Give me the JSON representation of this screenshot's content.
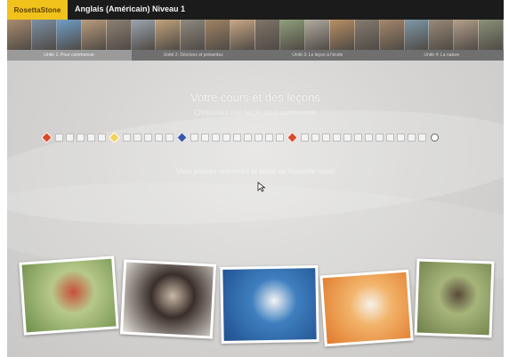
{
  "app": {
    "logo_text": "RosettaStone",
    "course_title": "Anglais (Américain) Niveau 1"
  },
  "image_strip": [
    {
      "icon": "group-photo",
      "color": "#a98b6e"
    },
    {
      "icon": "family-photo",
      "color": "#7b8fa3"
    },
    {
      "icon": "sky-photo",
      "color": "#6f9ec9"
    },
    {
      "icon": "people-photo",
      "color": "#b99c7c"
    },
    {
      "icon": "city-photo",
      "color": "#8d8072"
    },
    {
      "icon": "boat-photo",
      "color": "#9aa6ad"
    },
    {
      "icon": "portrait-photo",
      "color": "#c2a27a"
    },
    {
      "icon": "street-photo",
      "color": "#8f8a7e"
    },
    {
      "icon": "market-photo",
      "color": "#a18364"
    },
    {
      "icon": "child-photo",
      "color": "#c9a886"
    },
    {
      "icon": "crowd-photo",
      "color": "#7f7467"
    },
    {
      "icon": "garden-photo",
      "color": "#8ea07a"
    },
    {
      "icon": "clock-photo",
      "color": "#b1aaa0"
    },
    {
      "icon": "food-photo",
      "color": "#b98f63"
    },
    {
      "icon": "building-photo",
      "color": "#857b6f"
    },
    {
      "icon": "friends-photo",
      "color": "#a4876b"
    },
    {
      "icon": "water-photo",
      "color": "#7d99a8"
    },
    {
      "icon": "pattern-photo",
      "color": "#9a8a78"
    },
    {
      "icon": "fabric-photo",
      "color": "#b3a08a"
    },
    {
      "icon": "landscape-photo",
      "color": "#8a9279"
    }
  ],
  "units": [
    {
      "label": "Unité 1: Pour commencer",
      "active": true
    },
    {
      "label": "Unité 2: Décrivez et présentez",
      "active": false
    },
    {
      "label": "Unité 3: Le leçon à l'école",
      "active": false
    },
    {
      "label": "Unité 4: La nature",
      "active": false
    }
  ],
  "main": {
    "heading": "Votre cours et des leçons",
    "subheading": "Choisissez une leçon pour commencer",
    "prompt": "Vous pouvez reprendre la leçon ou Nouvelle leçon"
  },
  "lesson_track": [
    {
      "type": "marker",
      "color": "red"
    },
    {
      "type": "lesson"
    },
    {
      "type": "lesson"
    },
    {
      "type": "lesson"
    },
    {
      "type": "lesson"
    },
    {
      "type": "lesson"
    },
    {
      "type": "marker",
      "color": "yellow"
    },
    {
      "type": "lesson"
    },
    {
      "type": "lesson"
    },
    {
      "type": "lesson"
    },
    {
      "type": "lesson"
    },
    {
      "type": "lesson"
    },
    {
      "type": "marker",
      "color": "blue"
    },
    {
      "type": "lesson"
    },
    {
      "type": "lesson"
    },
    {
      "type": "lesson"
    },
    {
      "type": "lesson"
    },
    {
      "type": "lesson"
    },
    {
      "type": "lesson"
    },
    {
      "type": "lesson"
    },
    {
      "type": "lesson"
    },
    {
      "type": "lesson"
    },
    {
      "type": "marker",
      "color": "red"
    },
    {
      "type": "lesson"
    },
    {
      "type": "lesson"
    },
    {
      "type": "lesson"
    },
    {
      "type": "lesson"
    },
    {
      "type": "lesson"
    },
    {
      "type": "lesson"
    },
    {
      "type": "lesson"
    },
    {
      "type": "lesson"
    },
    {
      "type": "lesson"
    },
    {
      "type": "lesson"
    },
    {
      "type": "lesson"
    },
    {
      "type": "lesson"
    },
    {
      "type": "end"
    }
  ],
  "photos": [
    {
      "icon": "woman-outdoors-photo",
      "colors": [
        "#6f8f4c",
        "#b7c98a",
        "#c9503a"
      ]
    },
    {
      "icon": "family-reading-photo",
      "colors": [
        "#e8e4dd",
        "#3a2f2a",
        "#c8b8a6"
      ]
    },
    {
      "icon": "fish-underwater-photo",
      "colors": [
        "#1f4f8f",
        "#3f7fbf",
        "#f4f4f4"
      ]
    },
    {
      "icon": "friends-smiling-photo",
      "colors": [
        "#e07a2c",
        "#f2b46b",
        "#f6f1ea"
      ]
    },
    {
      "icon": "people-cooking-photo",
      "colors": [
        "#6f7f4a",
        "#a6b57a",
        "#5a4a3a"
      ]
    }
  ]
}
